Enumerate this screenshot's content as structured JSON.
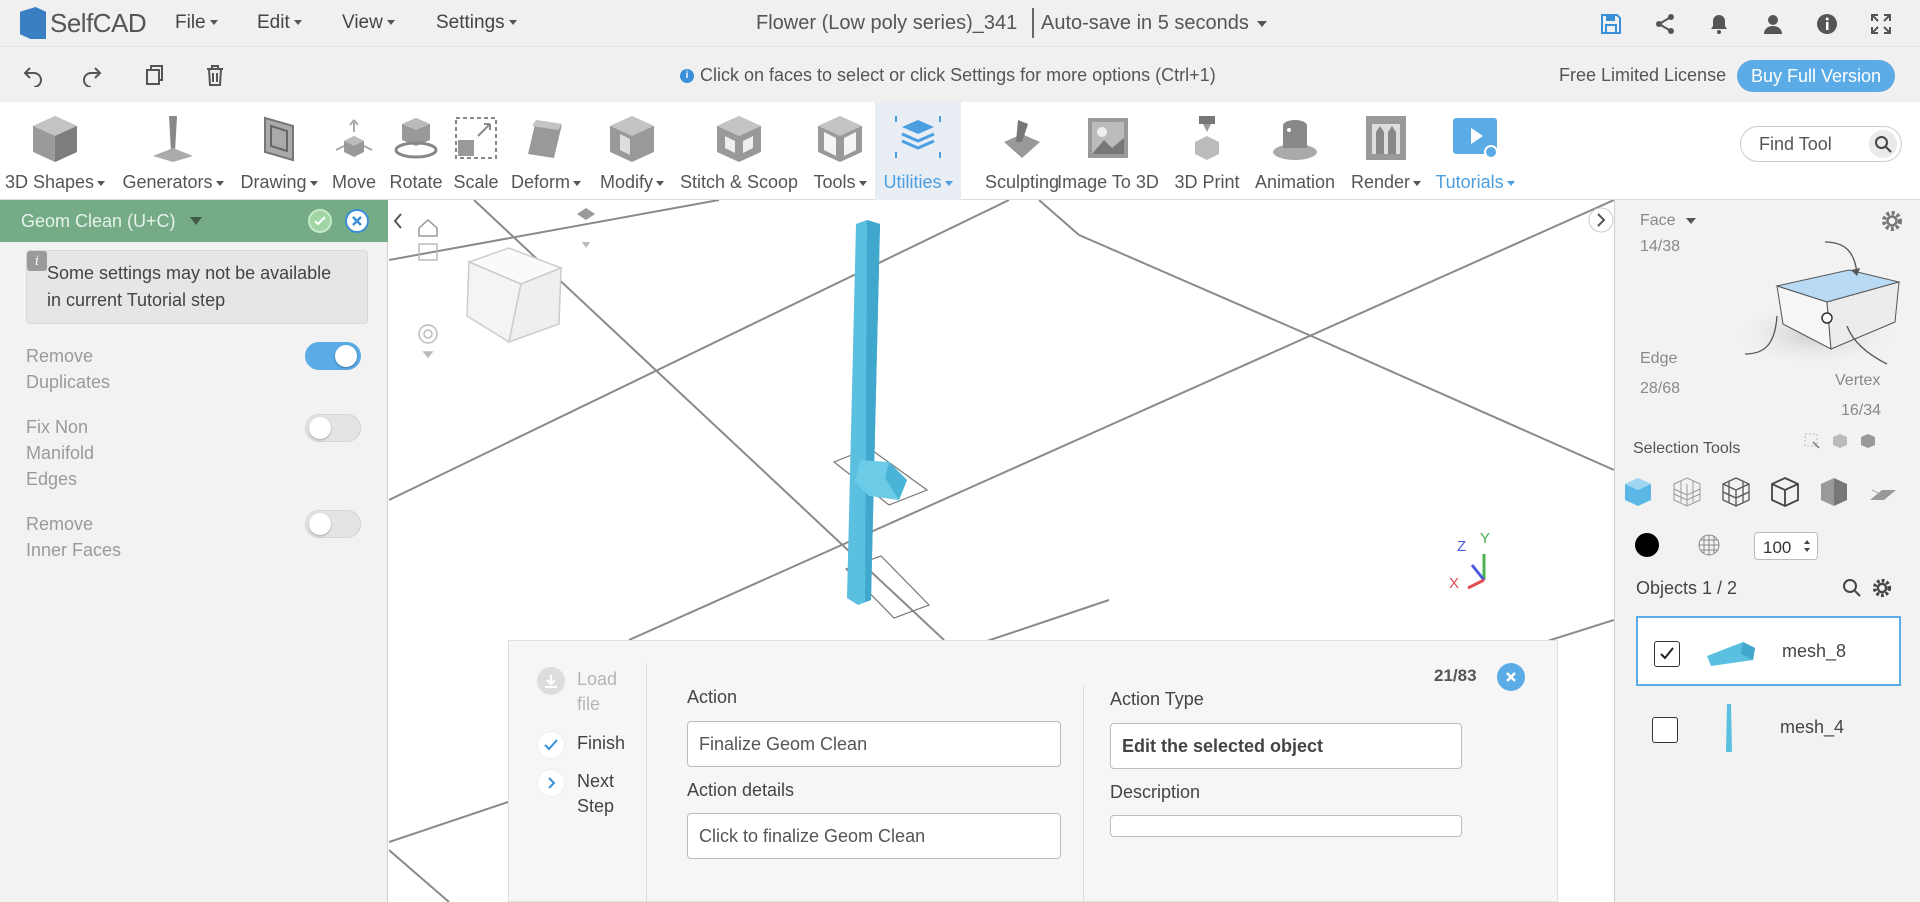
{
  "app": {
    "logo_text": "SelfCAD",
    "menu": [
      "File",
      "Edit",
      "View",
      "Settings"
    ],
    "document_title": "Flower (Low poly series)_341",
    "autosave": "Auto-save in 5 seconds"
  },
  "secondbar": {
    "hint": "Click on faces to select or click Settings for more options (Ctrl+1)",
    "license": "Free Limited License",
    "buy_button": "Buy Full Version"
  },
  "toolbar": {
    "tools": [
      {
        "label": "3D Shapes",
        "icon": "cube-icon",
        "dropdown": true
      },
      {
        "label": "Generators",
        "icon": "generators-icon",
        "dropdown": true
      },
      {
        "label": "Drawing",
        "icon": "drawing-icon",
        "dropdown": true
      },
      {
        "label": "Move",
        "icon": "move-icon",
        "dropdown": false
      },
      {
        "label": "Rotate",
        "icon": "rotate-icon",
        "dropdown": false
      },
      {
        "label": "Scale",
        "icon": "scale-icon",
        "dropdown": false
      },
      {
        "label": "Deform",
        "icon": "deform-icon",
        "dropdown": true
      },
      {
        "label": "Modify",
        "icon": "modify-icon",
        "dropdown": true
      },
      {
        "label": "Stitch & Scoop",
        "icon": "stitch-scoop-icon",
        "dropdown": false
      },
      {
        "label": "Tools",
        "icon": "tools-icon",
        "dropdown": true
      },
      {
        "label": "Utilities",
        "icon": "utilities-icon",
        "dropdown": true,
        "active": true
      },
      {
        "label": "Sculpting",
        "icon": "sculpting-icon",
        "dropdown": false
      },
      {
        "label": "Image To 3D",
        "icon": "image-to-3d-icon",
        "dropdown": false
      },
      {
        "label": "3D Print",
        "icon": "3d-print-icon",
        "dropdown": false
      },
      {
        "label": "Animation",
        "icon": "animation-icon",
        "dropdown": false
      },
      {
        "label": "Render",
        "icon": "render-icon",
        "dropdown": true
      },
      {
        "label": "Tutorials",
        "icon": "tutorials-icon",
        "dropdown": true,
        "blue": true
      }
    ],
    "find_tool_placeholder": "Find Tool"
  },
  "left_panel": {
    "title": "Geom Clean (U+C)",
    "notice": "Some settings may not be available in current Tutorial step",
    "options": [
      {
        "label": "Remove Duplicates",
        "enabled": true
      },
      {
        "label": "Fix Non Manifold Edges",
        "enabled": false
      },
      {
        "label": "Remove Inner Faces",
        "enabled": false
      }
    ]
  },
  "viewport": {
    "axis_labels": {
      "x": "X",
      "y": "Y",
      "z": "Z"
    },
    "colors": {
      "model": "#5bc0e0",
      "grid": "#8a8a8a"
    }
  },
  "right_panel": {
    "mode": "Face",
    "face_count": "14/38",
    "edge_label": "Edge",
    "edge_count": "28/68",
    "vertex_label": "Vertex",
    "vertex_count": "16/34",
    "selection_tools_label": "Selection Tools",
    "opacity": "100",
    "objects_label": "Objects 1 / 2",
    "objects": [
      {
        "name": "mesh_8",
        "checked": true,
        "selected": true
      },
      {
        "name": "mesh_4",
        "checked": false,
        "selected": false
      }
    ]
  },
  "tutorial": {
    "steps": [
      {
        "label": "Load file",
        "state": "disabled"
      },
      {
        "label": "Finish",
        "state": "done"
      },
      {
        "label": "Next Step",
        "state": "next"
      }
    ],
    "counter": "21/83",
    "action_label": "Action",
    "action_value": "Finalize Geom Clean",
    "action_details_label": "Action details",
    "action_details_value": "Click to finalize Geom Clean",
    "action_type_label": "Action Type",
    "action_type_value": "Edit the selected object",
    "description_label": "Description",
    "description_value": ""
  }
}
